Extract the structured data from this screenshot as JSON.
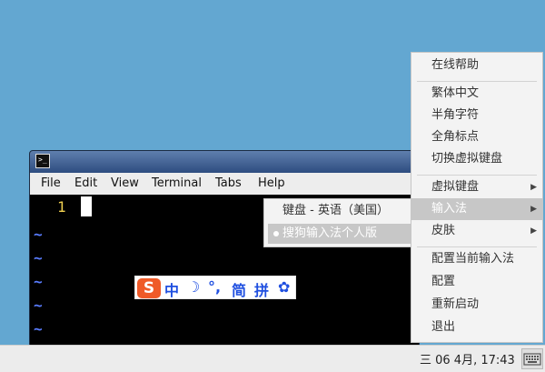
{
  "menubar": {
    "items": [
      "File",
      "Edit",
      "View",
      "Terminal",
      "Tabs",
      "Help"
    ]
  },
  "editor": {
    "line_number": "1",
    "tildes": [
      "~",
      "~",
      "~",
      "~",
      "~"
    ]
  },
  "ime_bar": {
    "logo": "S",
    "mode": "中",
    "moon": "☽",
    "punct": "°,",
    "simp": "简",
    "pinyin": "拼",
    "settings": "✿"
  },
  "submenu": {
    "items": [
      {
        "label": "键盘 - 英语（美国）",
        "selected": false
      },
      {
        "label": "搜狗输入法个人版",
        "selected": true
      }
    ]
  },
  "mainmenu": {
    "items": [
      {
        "label": "在线帮助"
      },
      {
        "label": "繁体中文"
      },
      {
        "label": "半角字符"
      },
      {
        "label": "全角标点"
      },
      {
        "label": "切换虚拟键盘"
      },
      {
        "label": "虚拟键盘",
        "arrow": "▶"
      },
      {
        "label": "输入法",
        "arrow": "▶",
        "selected": true
      },
      {
        "label": "皮肤",
        "arrow": "▶"
      },
      {
        "label": "配置当前输入法"
      },
      {
        "label": "配置"
      },
      {
        "label": "重新启动"
      },
      {
        "label": "退出"
      }
    ]
  },
  "taskbar": {
    "clock": "三 06 4月, 17:43"
  },
  "colors": {
    "desktop": "#63a7d1",
    "ime_blue": "#1f4fe0",
    "sogou_orange": "#ef5a28",
    "line_number": "#f0d050",
    "tilde": "#5a7dff"
  }
}
